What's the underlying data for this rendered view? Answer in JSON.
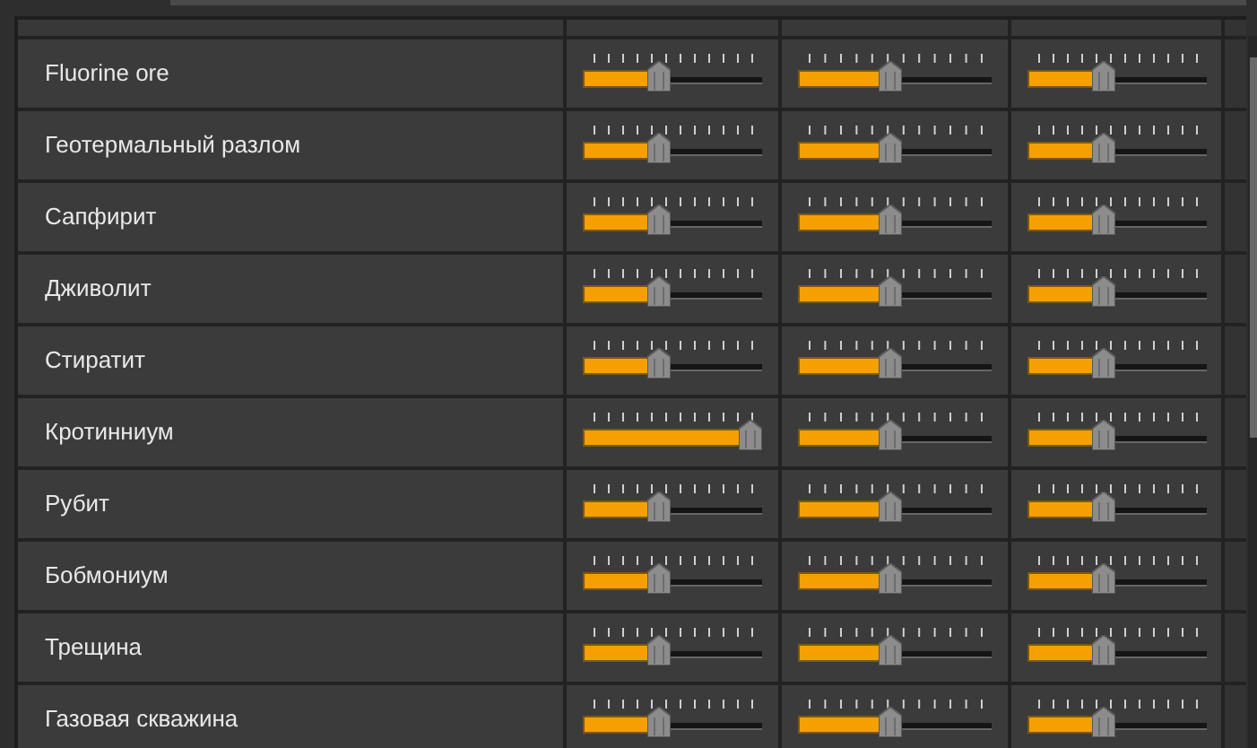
{
  "rows": [
    {
      "name": "Fluorine ore",
      "sliders": [
        {
          "level": 0.45
        },
        {
          "level": 0.5
        },
        {
          "level": 0.45
        }
      ]
    },
    {
      "name": "Геотермальный разлом",
      "sliders": [
        {
          "level": 0.45
        },
        {
          "level": 0.5
        },
        {
          "level": 0.45
        }
      ]
    },
    {
      "name": "Сапфирит",
      "sliders": [
        {
          "level": 0.45
        },
        {
          "level": 0.5
        },
        {
          "level": 0.45
        }
      ]
    },
    {
      "name": "Дживолит",
      "sliders": [
        {
          "level": 0.45
        },
        {
          "level": 0.5
        },
        {
          "level": 0.45
        }
      ]
    },
    {
      "name": "Стиратит",
      "sliders": [
        {
          "level": 0.45
        },
        {
          "level": 0.5
        },
        {
          "level": 0.45
        }
      ]
    },
    {
      "name": "Кротинниум",
      "sliders": [
        {
          "level": 1
        },
        {
          "level": 0.5
        },
        {
          "level": 0.45
        }
      ]
    },
    {
      "name": "Рубит",
      "sliders": [
        {
          "level": 0.45
        },
        {
          "level": 0.5
        },
        {
          "level": 0.45
        }
      ]
    },
    {
      "name": "Бобмониум",
      "sliders": [
        {
          "level": 0.45
        },
        {
          "level": 0.5
        },
        {
          "level": 0.45
        }
      ]
    },
    {
      "name": "Трещина",
      "sliders": [
        {
          "level": 0.45
        },
        {
          "level": 0.5
        },
        {
          "level": 0.45
        }
      ]
    },
    {
      "name": "Газовая скважина",
      "sliders": [
        {
          "level": 0.45
        },
        {
          "level": 0.5
        },
        {
          "level": 0.45
        }
      ]
    }
  ]
}
